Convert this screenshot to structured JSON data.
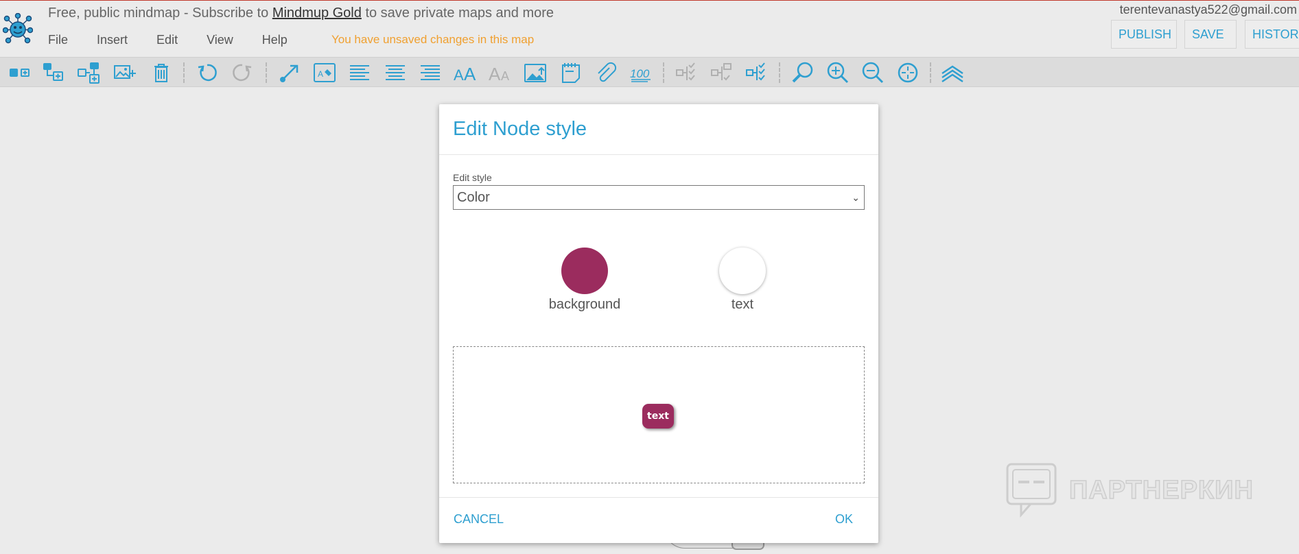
{
  "header": {
    "promo_prefix": "Free, public mindmap - Subscribe to",
    "promo_link": "Mindmup Gold",
    "promo_suffix": "to save private maps and more",
    "menu": [
      "File",
      "Insert",
      "Edit",
      "View",
      "Help"
    ],
    "unsaved_notice": "You have unsaved changes in this map",
    "user_email": "terentevanastya522@gmail.com",
    "publish_label": "PUBLISH",
    "save_label": "SAVE",
    "history_label": "HISTORY"
  },
  "toolbar": {
    "icons": [
      "add-sibling-icon",
      "add-child-icon",
      "add-parent-icon",
      "add-image-icon",
      "delete-icon",
      "undo-icon",
      "redo-icon",
      "link-nodes-icon",
      "edit-style-icon",
      "align-left-icon",
      "align-center-icon",
      "align-right-icon",
      "increase-font-icon",
      "decrease-font-icon",
      "image-icon",
      "note-icon",
      "attachment-icon",
      "progress-icon",
      "collapse-icon",
      "expand-icon",
      "select-icon",
      "find-icon",
      "zoom-in-icon",
      "zoom-out-icon",
      "center-icon",
      "layers-icon"
    ]
  },
  "dialog": {
    "title": "Edit Node style",
    "field_label": "Edit style",
    "selected_style": "Color",
    "background_label": "background",
    "text_label": "text",
    "preview_text": "text",
    "cancel_label": "CANCEL",
    "ok_label": "OK"
  },
  "colors": {
    "background": "#9b2c5e",
    "text": "#ffffff",
    "accent": "#2e9fd0",
    "unsaved": "#f0a030"
  },
  "watermark": "ПАРТНЕРКИН"
}
